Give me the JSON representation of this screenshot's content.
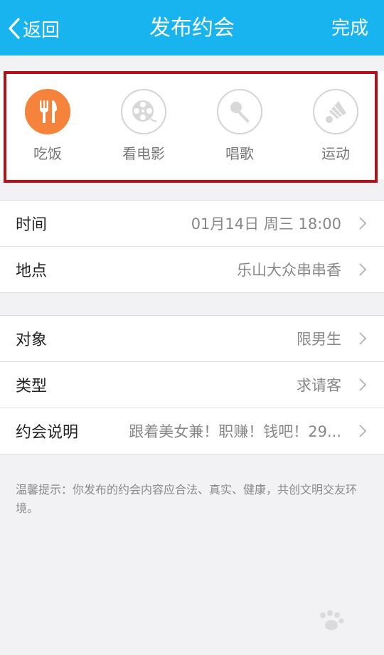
{
  "header": {
    "back_label": "返回",
    "title": "发布约会",
    "done_label": "完成",
    "background_color": "#18b4ef"
  },
  "categories": [
    {
      "label": "吃饭",
      "icon": "fork-knife-icon",
      "selected": true
    },
    {
      "label": "看电影",
      "icon": "film-reel-icon",
      "selected": false
    },
    {
      "label": "唱歌",
      "icon": "microphone-icon",
      "selected": false
    },
    {
      "label": "运动",
      "icon": "shuttlecock-icon",
      "selected": false
    }
  ],
  "accent_color": "#f5833c",
  "highlight_color": "#b3101a",
  "group1": [
    {
      "label": "时间",
      "value": "01月14日 周三 18:00"
    },
    {
      "label": "地点",
      "value": "乐山大众串串香"
    }
  ],
  "group2": [
    {
      "label": "对象",
      "value": "限男生"
    },
    {
      "label": "类型",
      "value": "求请客"
    },
    {
      "label": "约会说明",
      "value": "跟着美女兼！职赚！钱吧！29..."
    }
  ],
  "tip": "温馨提示：你发布的约会内容应合法、真实、健康，共创文明交友环境。"
}
